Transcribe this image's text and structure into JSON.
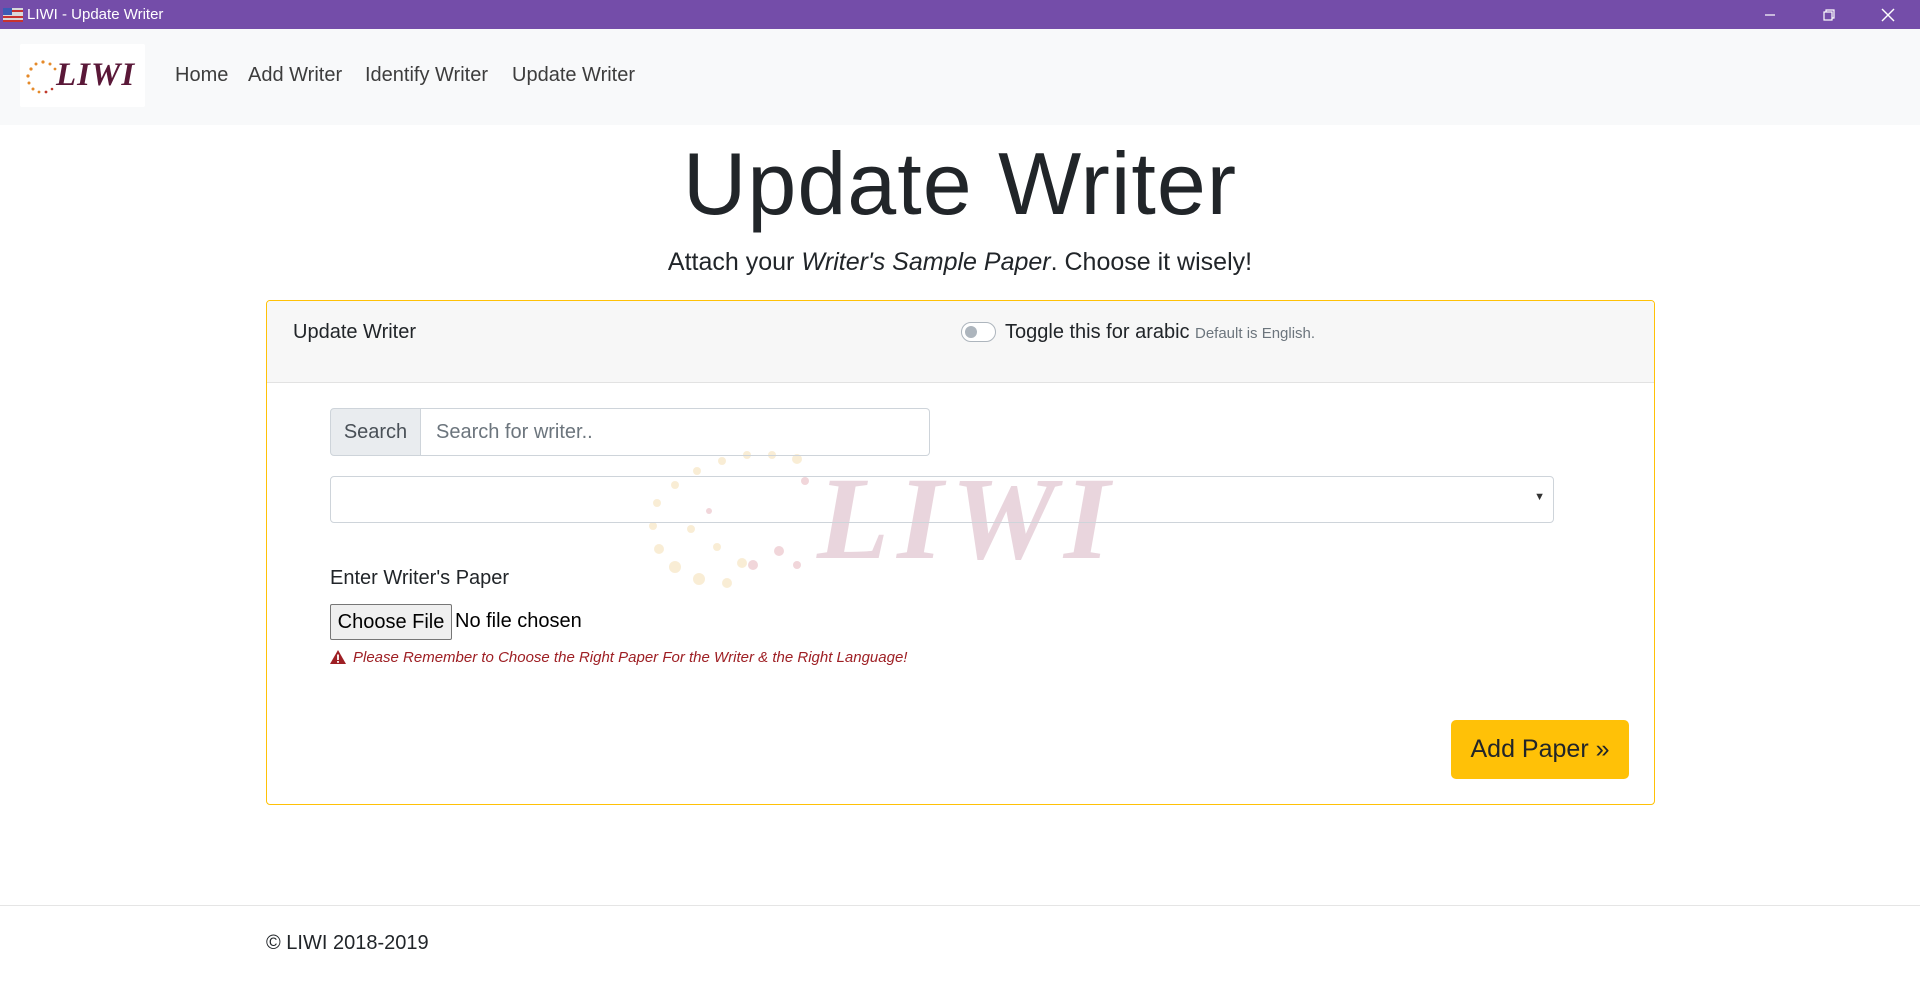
{
  "window": {
    "title": "LIWI - Update Writer",
    "minimize_icon": "minimize-icon",
    "maximize_icon": "restore-icon",
    "close_icon": "close-icon"
  },
  "navbar": {
    "brand": "LIWI",
    "links": [
      "Home",
      "Add Writer",
      "Identify Writer",
      "Update Writer"
    ]
  },
  "hero": {
    "title": "Update Writer",
    "lead_pre": "Attach your ",
    "lead_em": "Writer's Sample Paper",
    "lead_post": ". Choose it wisely!"
  },
  "card": {
    "title": "Update Writer",
    "toggle_label": "Toggle this for arabic",
    "toggle_hint": "Default is English.",
    "toggle_on": false,
    "watermark": "LIWI",
    "search": {
      "addon": "Search",
      "placeholder": "Search for writer..",
      "value": ""
    },
    "select_value": "",
    "paper_label": "Enter Writer's Paper",
    "file_button": "Choose File",
    "file_status": "No file chosen",
    "warning": "Please Remember to Choose the Right Paper For the Writer & the Right Language!",
    "submit": "Add Paper »"
  },
  "footer": {
    "text": "© LIWI 2018-2019"
  },
  "colors": {
    "titlebar": "#744da9",
    "accent": "#ffc107",
    "warning": "#9e1f24",
    "brand": "#5a1838"
  }
}
